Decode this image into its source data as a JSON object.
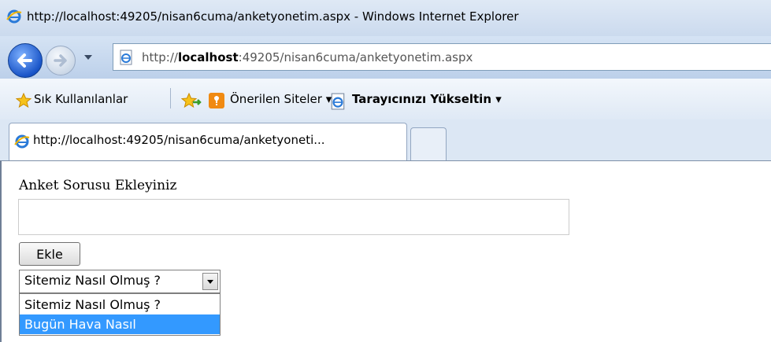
{
  "window": {
    "title": "http://localhost:49205/nisan6cuma/anketyonetim.aspx - Windows Internet Explorer"
  },
  "addressbar": {
    "url_prefix": "http://",
    "url_host": "localhost",
    "url_rest": ":49205/nisan6cuma/anketyonetim.aspx"
  },
  "favorites": {
    "fav_label": "Sık Kullanılanlar",
    "suggested_label": "Önerilen Siteler",
    "upgrade_label": "Tarayıcınızı Yükseltin"
  },
  "tabs": {
    "active_label": "http://localhost:49205/nisan6cuma/anketyoneti..."
  },
  "page": {
    "question_label": "Anket Sorusu Ekleyiniz",
    "question_value": "",
    "add_button": "Ekle",
    "select_value": "Sitemiz Nasıl Olmuş ?",
    "options": [
      "Sitemiz Nasıl Olmuş ?",
      "Bugün Hava Nasıl"
    ],
    "highlight_color": "#3399ff"
  },
  "icons": [
    "ie-icon",
    "back-arrow-icon",
    "forward-arrow-icon",
    "dropdown-icon",
    "page-icon",
    "star-icon",
    "add-favorite-icon",
    "suggested-sites-icon",
    "upgrade-icon"
  ]
}
